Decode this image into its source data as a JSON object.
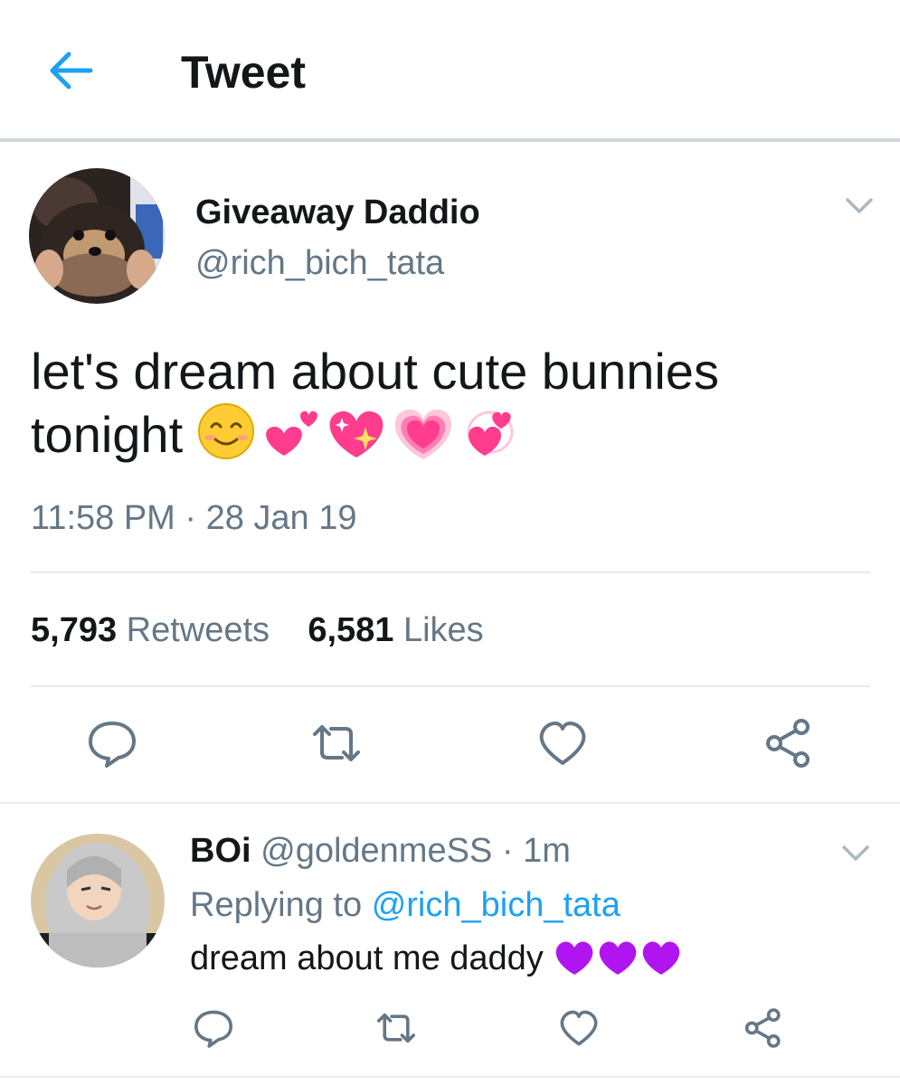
{
  "header": {
    "title": "Tweet",
    "back_icon": "arrow-left-icon",
    "accent": "#1da1f2"
  },
  "tweet": {
    "display_name": "Giveaway Daddio",
    "handle": "@rich_bich_tata",
    "text": "let's dream about cute bunnies tonight",
    "emojis": [
      "smiling-face-icon",
      "two-hearts-icon",
      "sparkling-heart-icon",
      "growing-heart-icon",
      "revolving-hearts-icon"
    ],
    "timestamp": "11:58 PM · 28 Jan 19",
    "retweets_count": "5,793",
    "retweets_label": "Retweets",
    "likes_count": "6,581",
    "likes_label": "Likes",
    "actions": [
      "reply-icon",
      "retweet-icon",
      "like-icon",
      "share-icon"
    ]
  },
  "reply": {
    "display_name": "BOi",
    "handle": "@goldenmeSS",
    "separator": "·",
    "time": "1m",
    "replying_prefix": "Replying to",
    "replying_handle": "@rich_bich_tata",
    "text": "dream about me daddy",
    "emojis": [
      "purple-heart-icon",
      "purple-heart-icon",
      "purple-heart-icon"
    ]
  },
  "colors": {
    "text": "#14171a",
    "secondary": "#657786",
    "divider": "#e6ecf0",
    "link": "#1da1f2",
    "heart_pink": "#ff3c8e",
    "heart_purple": "#b014f0"
  }
}
